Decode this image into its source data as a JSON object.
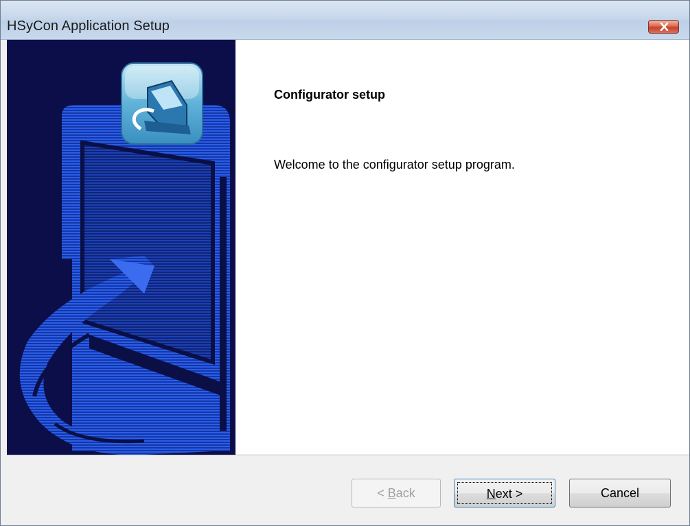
{
  "window": {
    "title": "HSyCon Application Setup"
  },
  "content": {
    "heading": "Configurator setup",
    "welcome": "Welcome to the configurator setup program."
  },
  "buttons": {
    "back": {
      "prefix": "< ",
      "accel": "B",
      "rest": "ack"
    },
    "next": {
      "accel": "N",
      "rest": "ext >"
    },
    "cancel": "Cancel"
  },
  "colors": {
    "banner_bg": "#0c0e4a",
    "banner_accent": "#1f4fd6",
    "title_bar": "#c7d7ea",
    "close_button": "#c8402a"
  },
  "icons": {
    "banner": "setup-wizard-graphic",
    "app": "computer-setup-icon",
    "close": "close-icon"
  }
}
